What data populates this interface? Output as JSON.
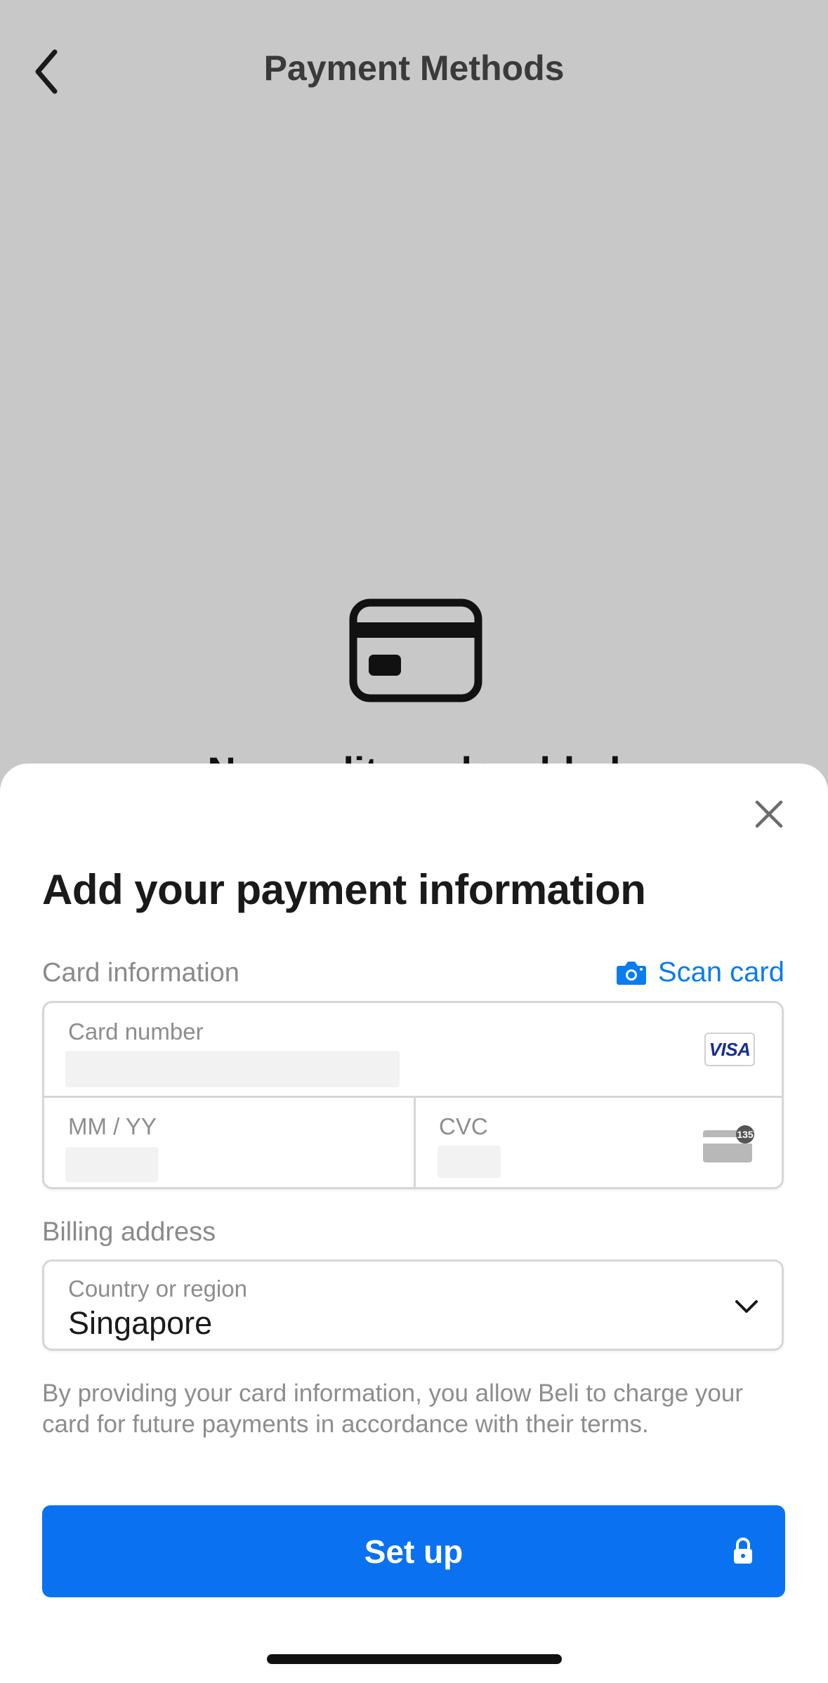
{
  "header": {
    "title": "Payment Methods",
    "back_icon": "chevron-left-icon"
  },
  "empty_state": {
    "icon": "credit-card-icon",
    "text": "No credit cards added"
  },
  "sheet": {
    "title": "Add your payment information",
    "close_icon": "close-icon",
    "card_section": {
      "label": "Card information",
      "scan_label": "Scan card",
      "scan_icon": "camera-icon",
      "card_number_placeholder": "Card number",
      "card_brand": "VISA",
      "expiry_placeholder": "MM / YY",
      "cvc_placeholder": "CVC",
      "cvc_badge": "135"
    },
    "billing_section": {
      "label": "Billing address",
      "country_label": "Country or region",
      "country_value": "Singapore"
    },
    "legal_text": "By providing your card information, you allow Beli to charge your card for future payments in accordance with their terms.",
    "submit": {
      "label": "Set up",
      "icon": "lock-icon"
    }
  },
  "colors": {
    "accent": "#0a72f0",
    "link": "#0a7cf0",
    "backdrop": "#c8c8c8"
  }
}
